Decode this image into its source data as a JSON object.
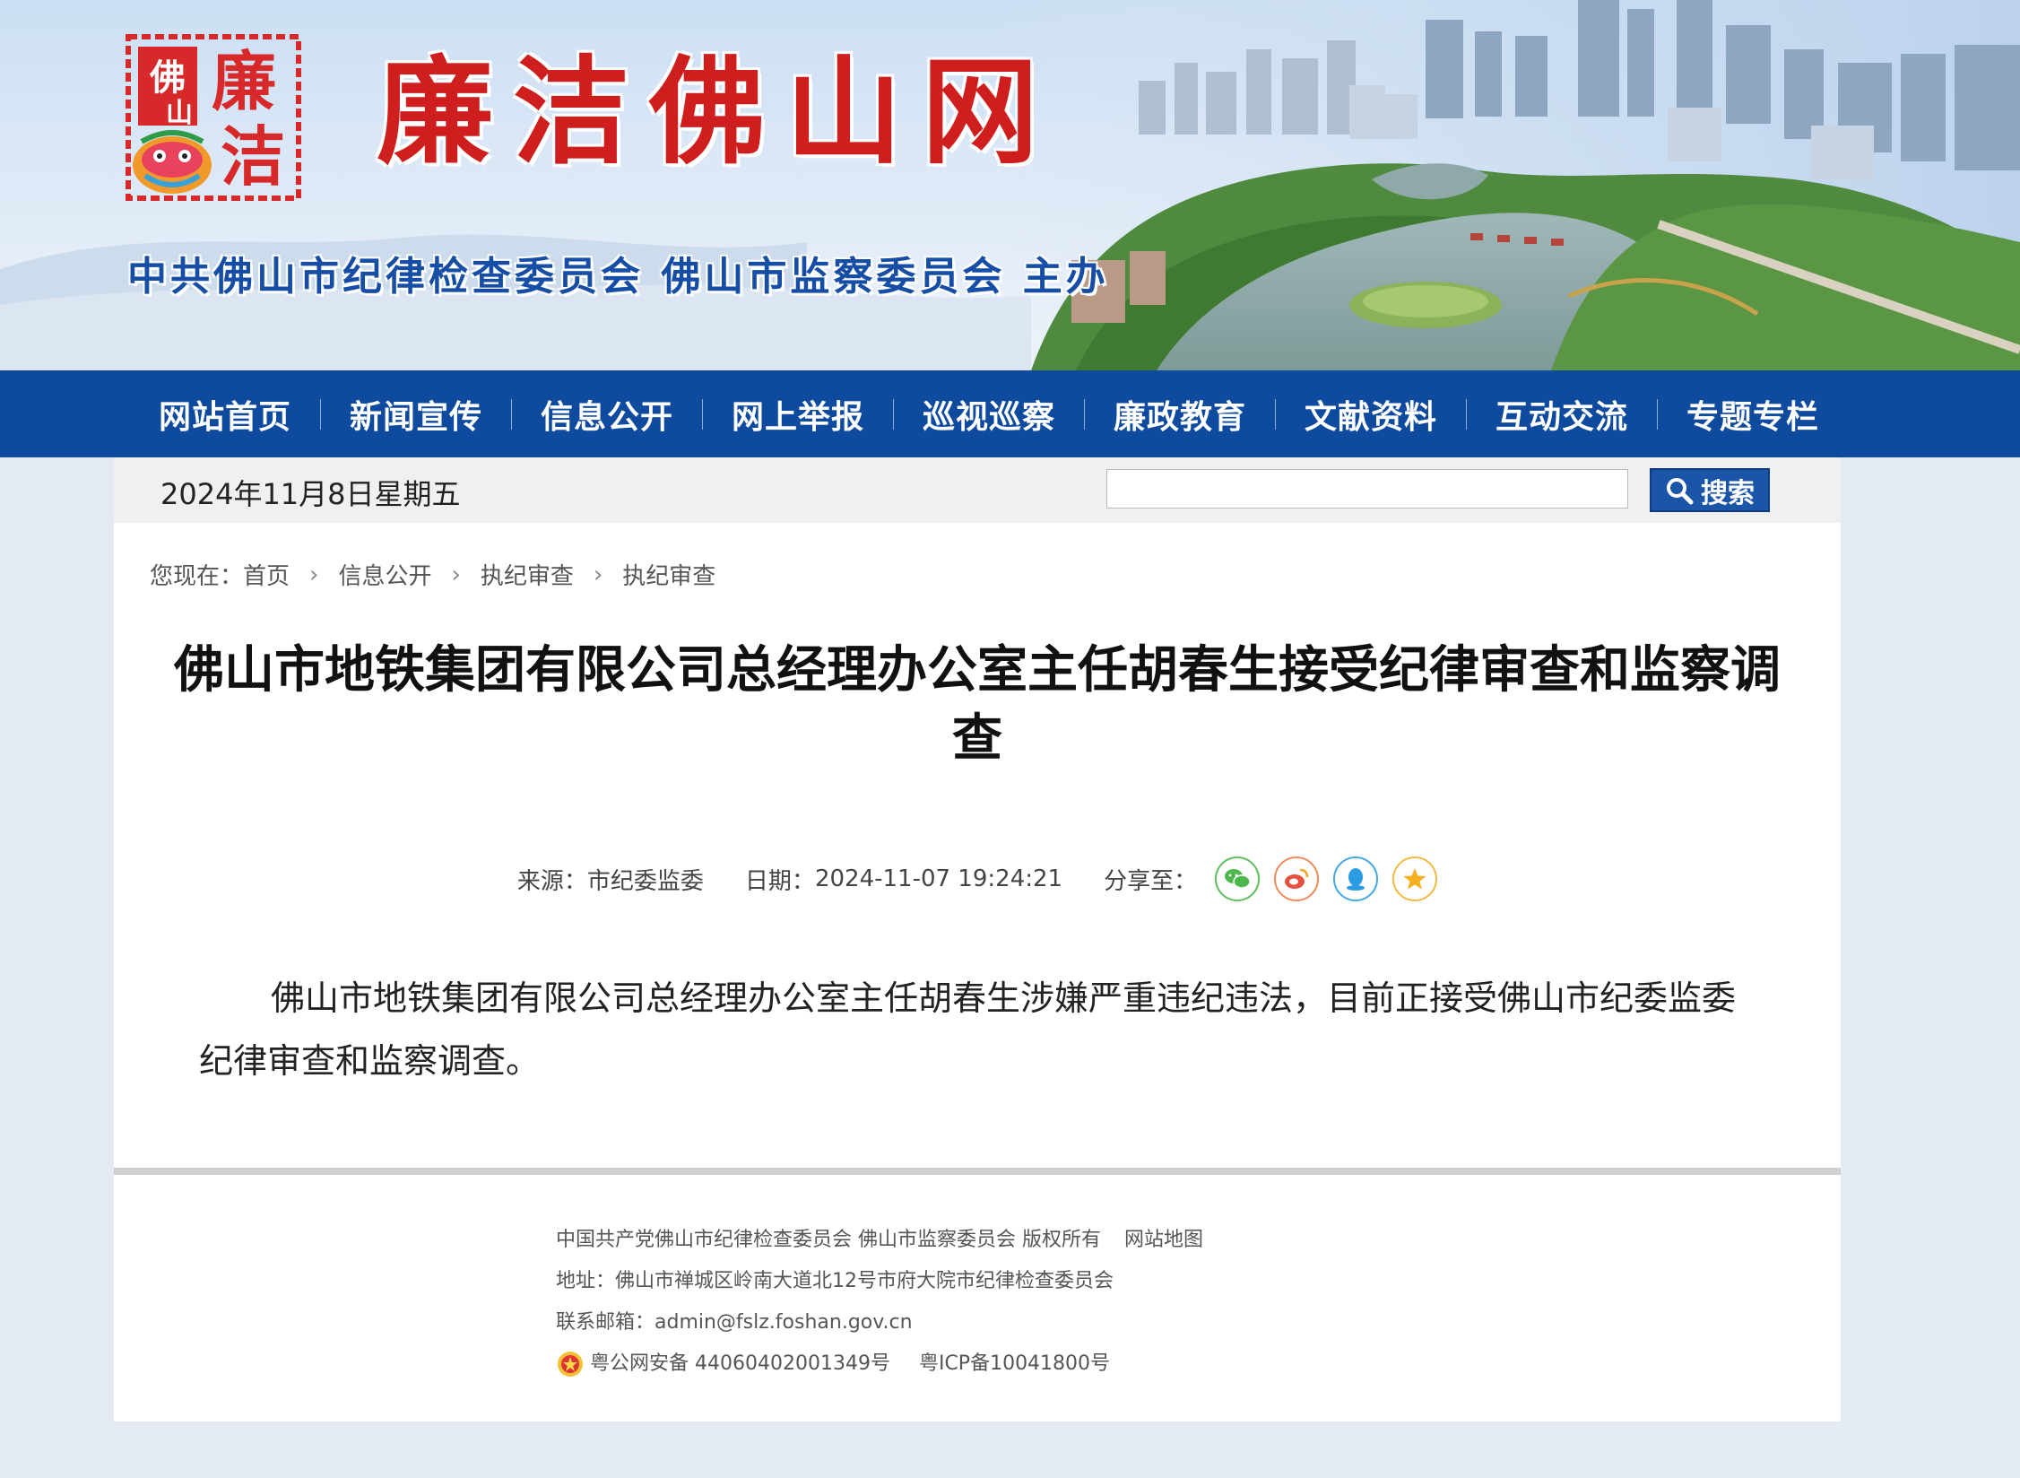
{
  "banner": {
    "logo_text": "佛山廉洁",
    "site_title": "廉洁佛山网",
    "sponsor": "中共佛山市纪律检查委员会  佛山市监察委员会  主办"
  },
  "nav": {
    "items": [
      "网站首页",
      "新闻宣传",
      "信息公开",
      "网上举报",
      "巡视巡察",
      "廉政教育",
      "文献资料",
      "互动交流",
      "专题专栏"
    ]
  },
  "toolbar": {
    "date": "2024年11月8日星期五",
    "search_placeholder": "",
    "search_label": "搜索"
  },
  "breadcrumb": {
    "prefix": "您现在：",
    "items": [
      "首页",
      "信息公开",
      "执纪审查",
      "执纪审查"
    ]
  },
  "article": {
    "title": "佛山市地铁集团有限公司总经理办公室主任胡春生接受纪律审查和监察调查",
    "source_label": "来源：",
    "source": "市纪委监委",
    "date_label": "日期：",
    "date": "2024-11-07 19:24:21",
    "share_label": "分享至：",
    "body": "佛山市地铁集团有限公司总经理办公室主任胡春生涉嫌严重违纪违法，目前正接受佛山市纪委监委纪律审查和监察调查。"
  },
  "share_icons": [
    "wechat-icon",
    "weibo-icon",
    "qq-icon",
    "qzone-icon"
  ],
  "footer": {
    "copyright": "中国共产党佛山市纪律检查委员会 佛山市监察委员会 版权所有",
    "sitemap": "网站地图",
    "address": "地址：佛山市禅城区岭南大道北12号市府大院市纪律检查委员会",
    "email": "联系邮箱：admin@fslz.foshan.gov.cn",
    "police_record": "粤公网安备 44060402001349号",
    "icp": "粤ICP备10041800号"
  },
  "colors": {
    "nav_bg": "#0e4a9e",
    "title_red": "#cf1e1e",
    "sponsor_blue": "#164ea6",
    "page_bg": "#e4eaf2"
  }
}
